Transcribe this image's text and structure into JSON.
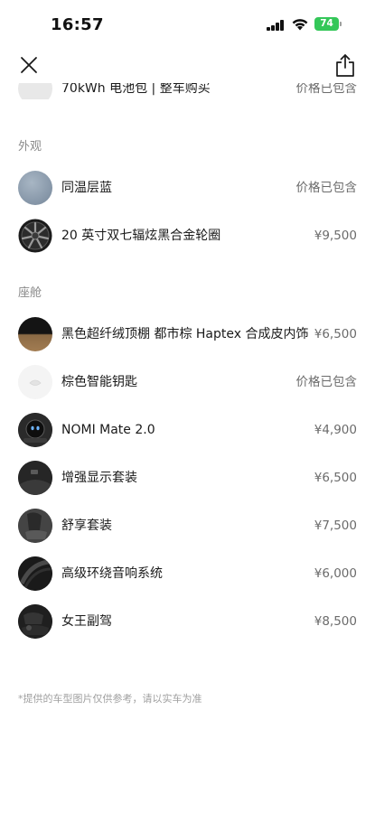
{
  "status_bar": {
    "time": "16:57",
    "battery": "74"
  },
  "partial_item": {
    "name": "70kWh 电池包 | 整车购买",
    "price": "价格已包含"
  },
  "sections": [
    {
      "title": "外观",
      "items": [
        {
          "name": "同温层蓝",
          "price": "价格已包含",
          "thumb": "color-swatch"
        },
        {
          "name": "20 英寸双七辐炫黑合金轮圈",
          "price": "¥9,500",
          "thumb": "wheel"
        }
      ]
    },
    {
      "title": "座舱",
      "items": [
        {
          "name": "黑色超纤绒顶棚 都市棕 Haptex 合成皮内饰",
          "price": "¥6,500",
          "thumb": "interior"
        },
        {
          "name": "棕色智能钥匙",
          "price": "价格已包含",
          "thumb": "key"
        },
        {
          "name": "NOMI Mate 2.0",
          "price": "¥4,900",
          "thumb": "nomi"
        },
        {
          "name": "增强显示套装",
          "price": "¥6,500",
          "thumb": "display"
        },
        {
          "name": "舒享套装",
          "price": "¥7,500",
          "thumb": "seat"
        },
        {
          "name": "高级环绕音响系统",
          "price": "¥6,000",
          "thumb": "speaker"
        },
        {
          "name": "女王副驾",
          "price": "¥8,500",
          "thumb": "queen-seat"
        }
      ]
    }
  ],
  "disclaimer": "*提供的车型图片仅供参考，请以实车为准",
  "colors": {
    "swatch_blue": "#8c9cad",
    "interior_brown": "#8b6a45",
    "battery_green": "#34c759"
  }
}
